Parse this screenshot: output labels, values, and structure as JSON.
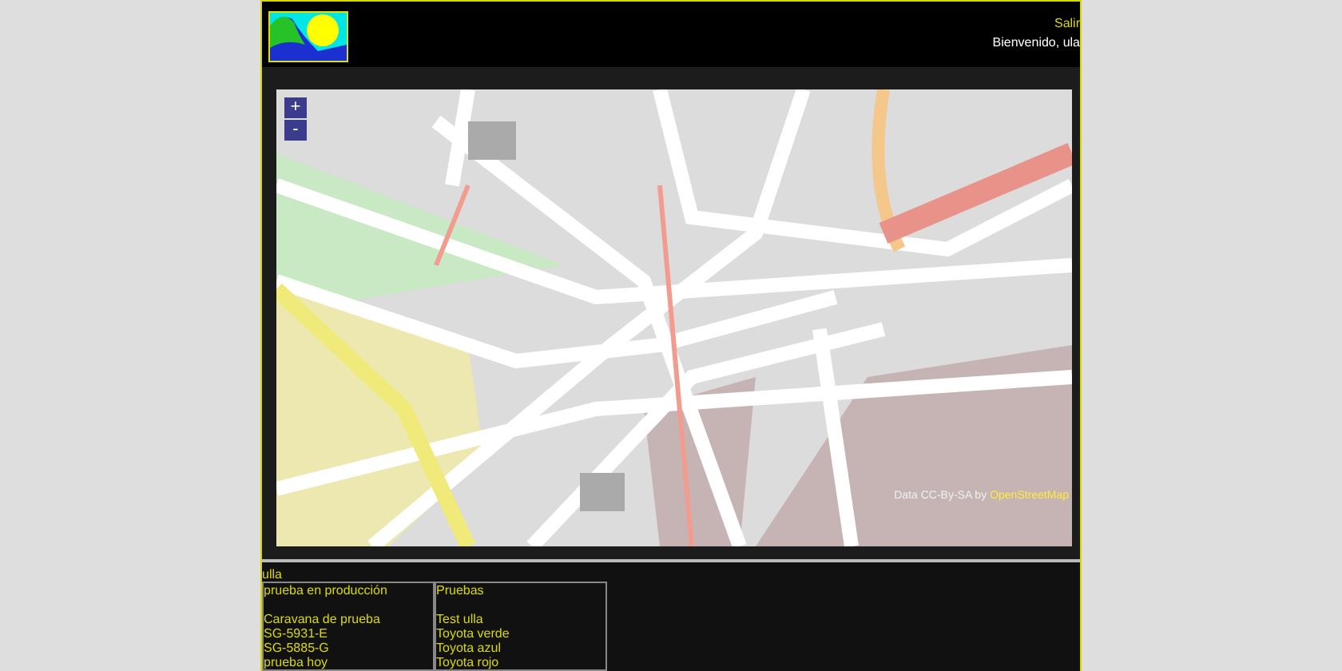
{
  "header": {
    "logout_link": "Salir",
    "welcome": "Bienvenido, ula"
  },
  "map": {
    "zoom_in": "+",
    "zoom_out": "-",
    "attribution_prefix": "Data CC-By-SA by",
    "attribution_link": "OpenStreetMap"
  },
  "footer": {
    "user": "ulla",
    "columns": [
      {
        "title": "prueba en producción",
        "items": [
          "Caravana de prueba",
          "SG-5931-E",
          "SG-5885-G",
          "prueba hoy"
        ]
      },
      {
        "title": "Pruebas",
        "items": [
          "Test ulla",
          "Toyota verde",
          "Toyota azul",
          "Toyota rojo"
        ]
      }
    ]
  }
}
